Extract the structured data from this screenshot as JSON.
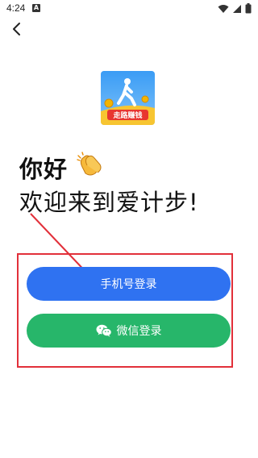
{
  "status_bar": {
    "time": "4:24",
    "notification_letter": "A"
  },
  "header": {
    "back_icon": "chevron-left-icon"
  },
  "logo": {
    "text": "走路赚钱",
    "icon": "walking-person-icon"
  },
  "greeting": {
    "hello": "你好",
    "welcome": "欢迎来到爱计步!"
  },
  "buttons": {
    "phone_login": "手机号登录",
    "wechat_login": "微信登录"
  },
  "colors": {
    "phone_button": "#2f72f1",
    "wechat_button": "#27b66a",
    "annotation_red": "#e2303a"
  }
}
